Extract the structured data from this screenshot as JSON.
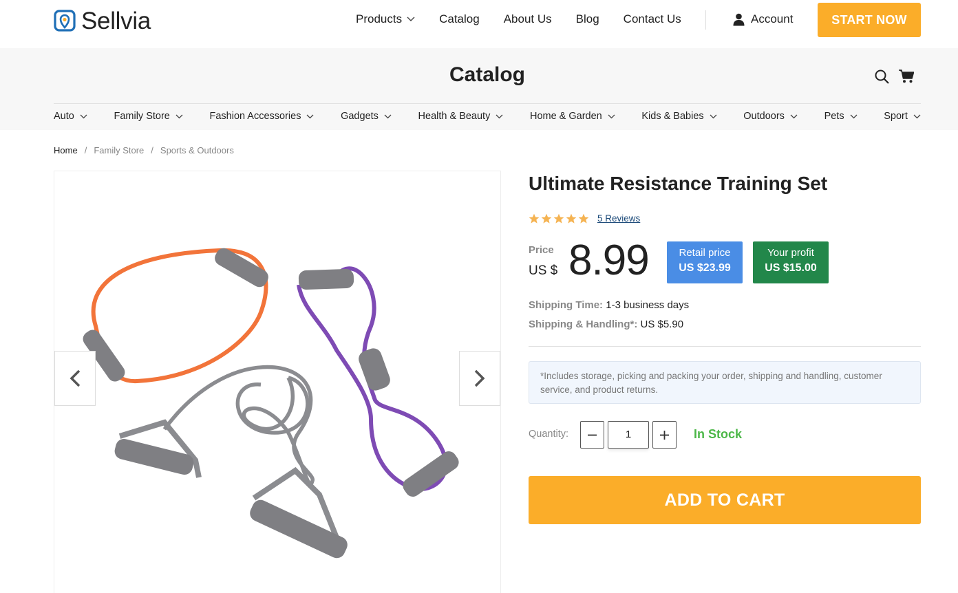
{
  "brand": {
    "name": "Sellvia",
    "accent": "#1f6fb6",
    "pin_color": "#fbad29"
  },
  "nav": {
    "items": [
      "Products",
      "Catalog",
      "About Us",
      "Blog",
      "Contact Us"
    ],
    "account_label": "Account",
    "cta_label": "START NOW"
  },
  "catalog": {
    "title": "Catalog",
    "categories": [
      "Auto",
      "Family Store",
      "Fashion Accessories",
      "Gadgets",
      "Health & Beauty",
      "Home & Garden",
      "Kids & Babies",
      "Outdoors",
      "Pets",
      "Sport"
    ]
  },
  "breadcrumb": [
    "Home",
    "Family Store",
    "Sports & Outdoors"
  ],
  "breadcrumb_separator": "/",
  "product": {
    "title": "Ultimate Resistance Training Set",
    "rating": 5,
    "reviews_label": "5 Reviews",
    "price_label": "Price",
    "currency": "US $",
    "price": "8.99",
    "retail_label": "Retail price",
    "retail_value": "US $23.99",
    "profit_label": "Your profit",
    "profit_value": "US $15.00",
    "shipping_time_label": "Shipping Time:",
    "shipping_time_value": "1-3 business days",
    "shipping_handling_label": "Shipping & Handling*:",
    "shipping_handling_value": "US $5.90",
    "note": "*Includes storage, picking and packing your order, shipping and handling, customer service, and product returns.",
    "quantity_label": "Quantity:",
    "quantity": "1",
    "stock_status": "In Stock",
    "add_to_cart_label": "ADD TO CART"
  },
  "colors": {
    "cta": "#fbad29",
    "retail_badge": "#4a8de5",
    "profit_badge": "#22874a",
    "in_stock": "#4cb748",
    "star": "#f5b352"
  },
  "icons": [
    "logo-pin-icon",
    "chevron-down-icon",
    "user-icon",
    "search-icon",
    "cart-icon",
    "star-icon",
    "chevron-left-icon",
    "chevron-right-icon",
    "minus-icon",
    "plus-icon"
  ]
}
